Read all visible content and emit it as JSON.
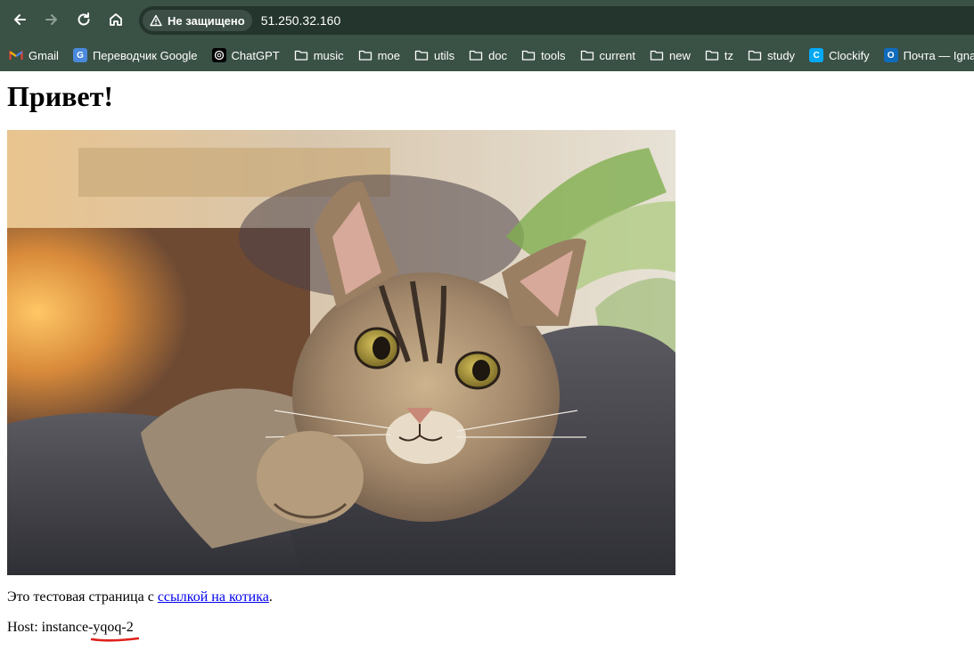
{
  "browser": {
    "security_label": "Не защищено",
    "url": "51.250.32.160",
    "bookmarks": [
      {
        "label": "Gmail",
        "icon": "gmail-icon"
      },
      {
        "label": "Переводчик Google",
        "icon": "google-translate-icon"
      },
      {
        "label": "ChatGPT",
        "icon": "chatgpt-icon"
      },
      {
        "label": "music",
        "icon": "folder-icon"
      },
      {
        "label": "moe",
        "icon": "folder-icon"
      },
      {
        "label": "utils",
        "icon": "folder-icon"
      },
      {
        "label": "doc",
        "icon": "folder-icon"
      },
      {
        "label": "tools",
        "icon": "folder-icon"
      },
      {
        "label": "current",
        "icon": "folder-icon"
      },
      {
        "label": "new",
        "icon": "folder-icon"
      },
      {
        "label": "tz",
        "icon": "folder-icon"
      },
      {
        "label": "study",
        "icon": "folder-icon"
      },
      {
        "label": "Clockify",
        "icon": "clockify-icon"
      },
      {
        "label": "Почта — Ignat",
        "icon": "outlook-icon"
      }
    ]
  },
  "page": {
    "heading": "Привет!",
    "intro_prefix": "Это тестовая страница с ",
    "link_text": "ссылкой на котика",
    "intro_suffix": ".",
    "host_label": "Host: ",
    "host_value": "instance-yqoq-2",
    "image_subject": "tabby-cat-photo"
  },
  "colors": {
    "chrome_bg": "#3a5146",
    "omnibox_bg": "#24352d",
    "link": "#0000ee",
    "annotation_underline": "#e0201b"
  }
}
